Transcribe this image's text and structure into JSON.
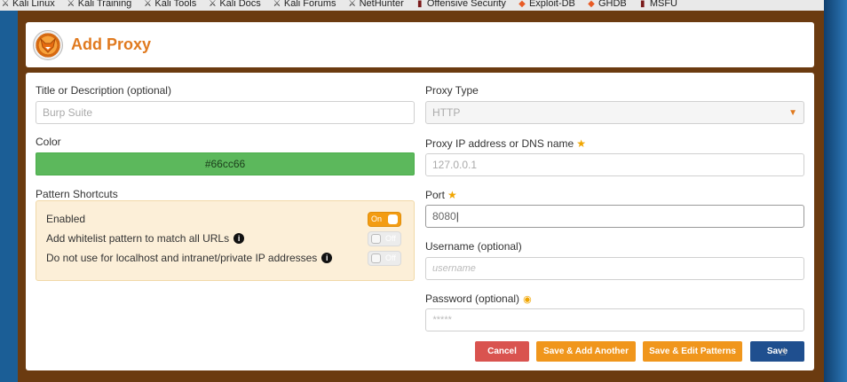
{
  "bookmarks": [
    {
      "label": "Kali Linux",
      "icon": "dragon-icon"
    },
    {
      "label": "Kali Training",
      "icon": "dragon-icon"
    },
    {
      "label": "Kali Tools",
      "icon": "dragon-icon"
    },
    {
      "label": "Kali Docs",
      "icon": "dragon-icon"
    },
    {
      "label": "Kali Forums",
      "icon": "dragon-icon"
    },
    {
      "label": "NetHunter",
      "icon": "dragon-icon"
    },
    {
      "label": "Offensive Security",
      "icon": "book-icon"
    },
    {
      "label": "Exploit-DB",
      "icon": "flame-icon"
    },
    {
      "label": "GHDB",
      "icon": "flame-icon"
    },
    {
      "label": "MSFU",
      "icon": "book-icon"
    }
  ],
  "header": {
    "title": "Add Proxy"
  },
  "form": {
    "title_label": "Title or Description (optional)",
    "title_placeholder": "Burp Suite",
    "color_label": "Color",
    "color_value": "#66cc66",
    "pattern_label": "Pattern Shortcuts",
    "patterns": [
      {
        "label": "Enabled",
        "state": "On",
        "info": false
      },
      {
        "label": "Add whitelist pattern to match all URLs",
        "state": "Off",
        "info": true
      },
      {
        "label": "Do not use for localhost and intranet/private IP addresses",
        "state": "Off",
        "info": true
      }
    ],
    "proxy_type_label": "Proxy Type",
    "proxy_type_value": "HTTP",
    "ip_label": "Proxy IP address or DNS name",
    "ip_placeholder": "127.0.0.1",
    "port_label": "Port",
    "port_value": "8080",
    "username_label": "Username (optional)",
    "username_placeholder": "username",
    "password_label": "Password (optional)",
    "password_placeholder": "*****"
  },
  "buttons": {
    "cancel": "Cancel",
    "save_add_another": "Save & Add Another",
    "save_edit_patterns": "Save & Edit Patterns",
    "save": "Save"
  },
  "colors": {
    "accent": "#e07a1f",
    "color_swatch": "#66cc66",
    "cancel": "#d9534f",
    "save": "#1f4f8f"
  }
}
